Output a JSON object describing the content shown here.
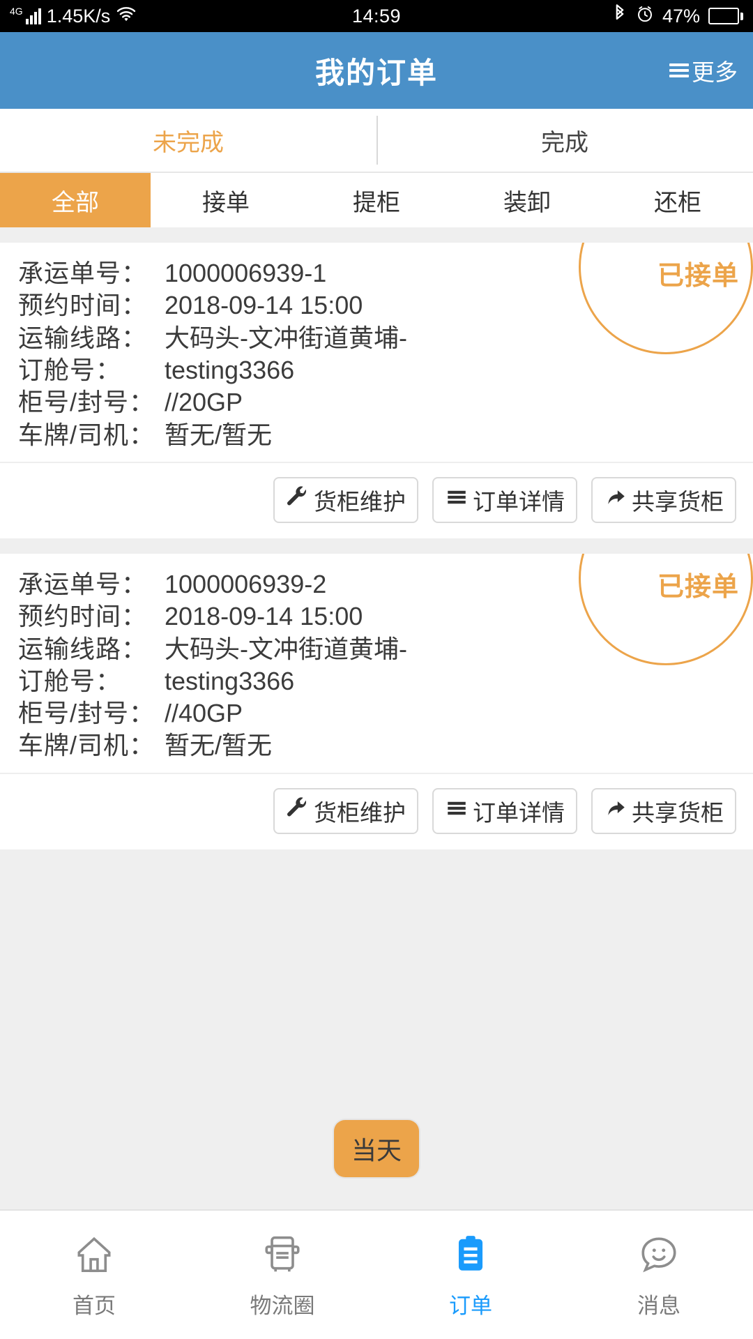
{
  "status_bar": {
    "network_type": "4G",
    "speed": "1.45K/s",
    "wifi_icon": "wifi-icon",
    "time": "14:59",
    "bluetooth_icon": "bluetooth-icon",
    "alarm_icon": "alarm-icon",
    "battery_percent": "47%"
  },
  "header": {
    "title": "我的订单",
    "more_label": "更多",
    "background_color": "#4a90c8"
  },
  "main_tabs": [
    {
      "label": "未完成",
      "active": true
    },
    {
      "label": "完成",
      "active": false
    }
  ],
  "sub_tabs": [
    {
      "label": "全部",
      "active": true
    },
    {
      "label": "接单",
      "active": false
    },
    {
      "label": "提柜",
      "active": false
    },
    {
      "label": "装卸",
      "active": false
    },
    {
      "label": "还柜",
      "active": false
    }
  ],
  "field_labels": {
    "waybill": "承运单号：",
    "appointment": "预约时间：",
    "route": "运输线路：",
    "booking": "订舱号：",
    "container": "柜号/封号：",
    "driver": "车牌/司机："
  },
  "actions": {
    "maintain": "货柜维护",
    "detail": "订单详情",
    "share": "共享货柜"
  },
  "orders": [
    {
      "status_badge": "已接单",
      "waybill": "1000006939-1",
      "appointment": "2018-09-14 15:00",
      "route": "大码头-文冲街道黄埔-",
      "booking": "testing3366",
      "container": "//20GP",
      "driver": "暂无/暂无"
    },
    {
      "status_badge": "已接单",
      "waybill": "1000006939-2",
      "appointment": "2018-09-14 15:00",
      "route": "大码头-文冲街道黄埔-",
      "booking": "testing3366",
      "container": "//40GP",
      "driver": "暂无/暂无"
    }
  ],
  "floating_button": {
    "label": "当天",
    "color": "#eca44a"
  },
  "bottom_nav": [
    {
      "label": "首页",
      "icon": "home-icon",
      "active": false
    },
    {
      "label": "物流圈",
      "icon": "truck-icon",
      "active": false
    },
    {
      "label": "订单",
      "icon": "clipboard-icon",
      "active": true
    },
    {
      "label": "消息",
      "icon": "smiley-chat-icon",
      "active": false
    }
  ],
  "colors": {
    "accent": "#eca44a",
    "brand": "#4a90c8",
    "active_nav": "#1a9bfc"
  }
}
